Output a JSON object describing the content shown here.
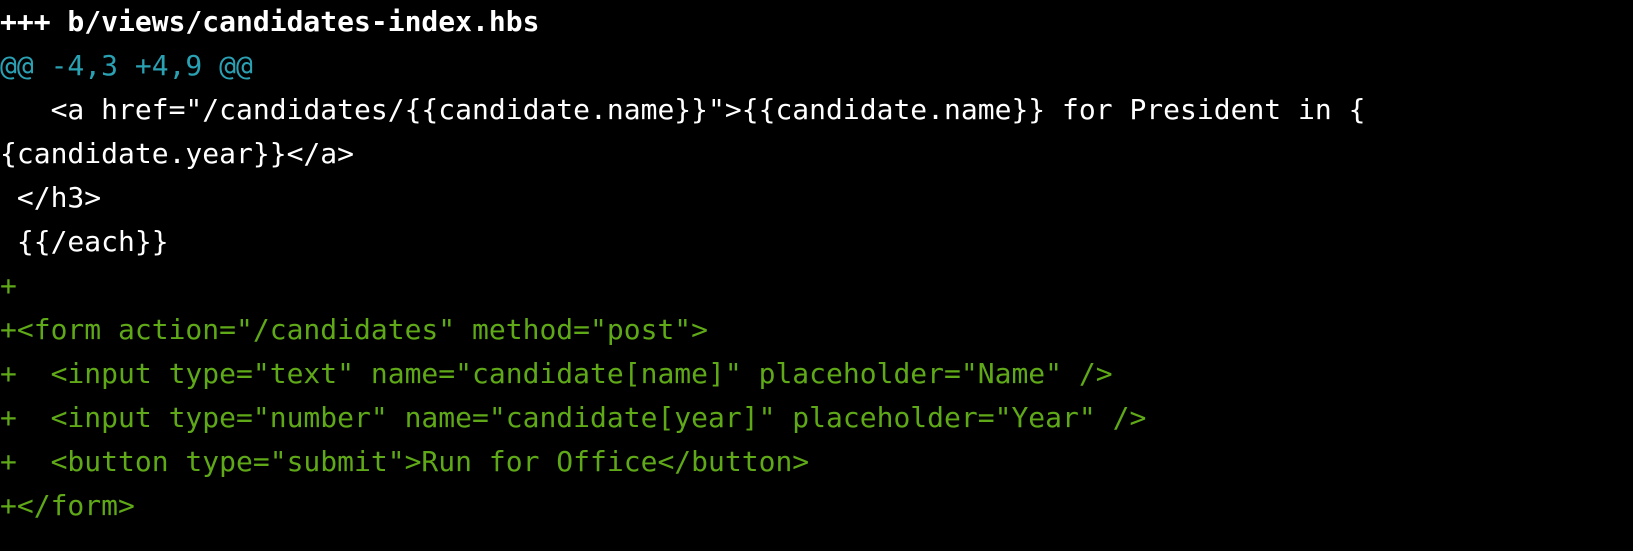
{
  "diff": {
    "lines": [
      {
        "type": "header",
        "text": "+++ b/views/candidates-index.hbs"
      },
      {
        "type": "hunk",
        "text": "@@ -4,3 +4,9 @@"
      },
      {
        "type": "context",
        "text": "   <a href=\"/candidates/{{candidate.name}}\">{{candidate.name}} for President in {"
      },
      {
        "type": "context",
        "text": "{candidate.year}}</a>"
      },
      {
        "type": "context",
        "text": " </h3>"
      },
      {
        "type": "context",
        "text": " {{/each}}"
      },
      {
        "type": "added",
        "text": "+"
      },
      {
        "type": "added",
        "text": "+<form action=\"/candidates\" method=\"post\">"
      },
      {
        "type": "added",
        "text": "+  <input type=\"text\" name=\"candidate[name]\" placeholder=\"Name\" />"
      },
      {
        "type": "added",
        "text": "+  <input type=\"number\" name=\"candidate[year]\" placeholder=\"Year\" />"
      },
      {
        "type": "added",
        "text": "+  <button type=\"submit\">Run for Office</button>"
      },
      {
        "type": "added",
        "text": "+</form>"
      }
    ]
  },
  "colors": {
    "background": "#000000",
    "header": "#ffffff",
    "hunk": "#2aa1b3",
    "context": "#ffffff",
    "added": "#5fa818"
  }
}
